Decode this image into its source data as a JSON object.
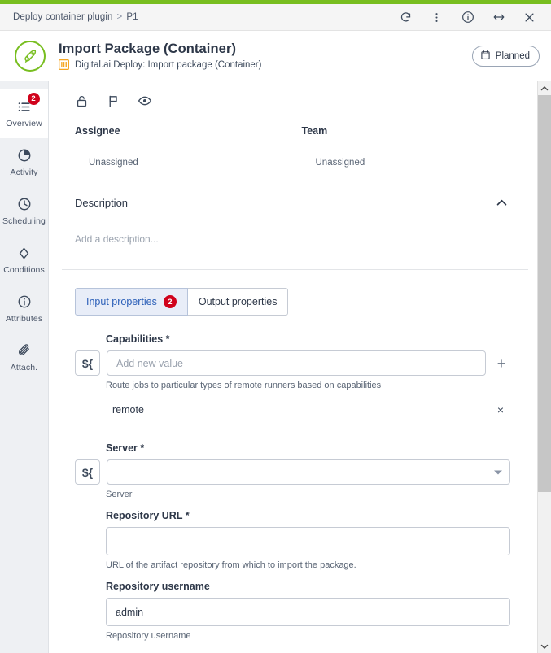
{
  "window": {
    "breadcrumb": [
      "Deploy container plugin",
      "P1"
    ],
    "breadcrumb_separator": ">",
    "icons": [
      {
        "name": "refresh-icon",
        "label": "Refresh"
      },
      {
        "name": "more-vertical-icon",
        "label": "More options"
      },
      {
        "name": "info-icon",
        "label": "Info"
      },
      {
        "name": "resize-horizontal-icon",
        "label": "Resize"
      },
      {
        "name": "close-icon",
        "label": "Close"
      }
    ],
    "accent_green": "#78be20",
    "breadcrumb_bg": "#f5f5f5"
  },
  "header": {
    "logo_icon": "rocket-icon",
    "logo_border_color": "#78be20",
    "title": "Import Package (Container)",
    "plugin_icon": "plugin-bars-icon",
    "plugin_icon_color": "#f5a623",
    "subtitle": "Digital.ai Deploy: Import package (Container)",
    "status_badge": {
      "icon": "calendar-icon",
      "label": "Planned"
    }
  },
  "sidebar": {
    "items": [
      {
        "label": "Overview",
        "icon": "list-icon",
        "badge": "2",
        "active": true
      },
      {
        "label": "Activity",
        "icon": "pie-chart-icon",
        "badge": null,
        "active": false
      },
      {
        "label": "Scheduling",
        "icon": "clock-icon",
        "badge": null,
        "active": false
      },
      {
        "label": "Conditions",
        "icon": "diamond-icon",
        "badge": null,
        "active": false
      },
      {
        "label": "Attributes",
        "icon": "info-circle-icon",
        "badge": null,
        "active": false
      },
      {
        "label": "Attach.",
        "icon": "paperclip-icon",
        "badge": null,
        "active": false
      }
    ],
    "badge_color": "#d0021b"
  },
  "toolbar": {
    "icons": [
      {
        "name": "unlock-icon",
        "label": "Lock"
      },
      {
        "name": "flag-icon",
        "label": "Flag"
      },
      {
        "name": "eye-icon",
        "label": "Watch"
      }
    ]
  },
  "details": {
    "assignee_label": "Assignee",
    "assignee_value": "Unassigned",
    "team_label": "Team",
    "team_value": "Unassigned"
  },
  "description": {
    "heading": "Description",
    "collapse_icon": "chevron-up-icon",
    "placeholder": "Add a description..."
  },
  "tabs": [
    {
      "label": "Input properties",
      "badge": "2",
      "active": true
    },
    {
      "label": "Output properties",
      "badge": null,
      "active": false
    }
  ],
  "form": {
    "expression_button_label": "${",
    "add_button_label": "+",
    "remove_button_label": "×",
    "fields": [
      {
        "label": "Capabilities",
        "required": true,
        "required_marker": "*",
        "type": "multivalue",
        "has_expression_button": true,
        "value": "",
        "placeholder": "Add new value",
        "hint": "Route jobs to particular types of remote runners based on capabilities",
        "chips": [
          "remote"
        ]
      },
      {
        "label": "Server",
        "required": true,
        "required_marker": "*",
        "type": "select",
        "has_expression_button": true,
        "value": "",
        "placeholder": "",
        "hint": "Server",
        "chips": []
      },
      {
        "label": "Repository URL",
        "required": true,
        "required_marker": "*",
        "type": "text",
        "has_expression_button": false,
        "value": "",
        "placeholder": "",
        "hint": "URL of the artifact repository from which to import the package.",
        "chips": []
      },
      {
        "label": "Repository username",
        "required": false,
        "required_marker": "",
        "type": "text",
        "has_expression_button": false,
        "value": "admin",
        "placeholder": "",
        "hint": "Repository username",
        "chips": []
      }
    ]
  },
  "scrollbar": {
    "up_icon": "chevron-up-icon",
    "down_icon": "chevron-down-icon"
  }
}
